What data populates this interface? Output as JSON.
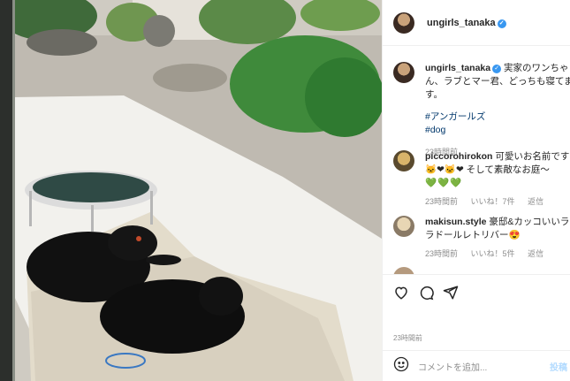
{
  "post": {
    "username": "ungirls_tanaka",
    "caption": "実家のワンちゃん、ラブとマー君、どっちも寝てます。",
    "hashtags": [
      "#アンガールズ",
      "#dog"
    ],
    "caption_time": "23時間前"
  },
  "comments": [
    {
      "username": "piccorohirokon",
      "text": "可愛いお名前ですね🐱❤🐱❤ そして素敵なお庭〜",
      "hearts": "💚💚💚",
      "time": "23時間前",
      "likes": "いいね！7件",
      "reply": "返信"
    },
    {
      "username": "makisun.style",
      "text": "豪邸&カッコいいラブラドールレトリバー😍",
      "time": "23時間前",
      "likes": "いいね！5件",
      "reply": "返信"
    }
  ],
  "footer": {
    "time": "23時間前",
    "comment_placeholder": "コメントを追加...",
    "post_label": "投稿"
  },
  "icons": {
    "verified": "verified-icon",
    "like": "heart-icon",
    "comment": "comment-icon",
    "share": "send-icon",
    "emoji": "emoji-icon"
  },
  "colors": {
    "verified": "#3897f0",
    "link": "#00376b",
    "muted": "#8e8e8e",
    "post_disabled": "#b3dbff"
  }
}
